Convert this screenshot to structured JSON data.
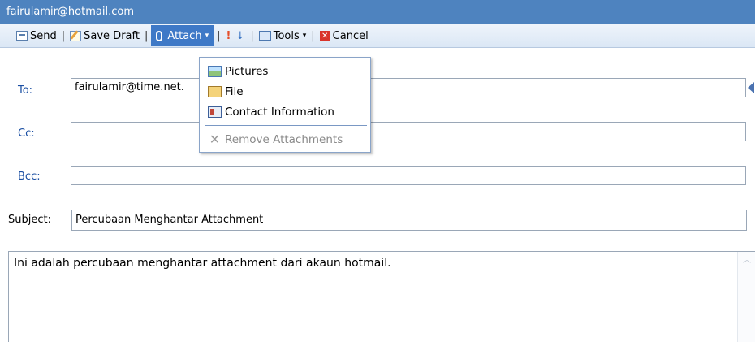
{
  "window": {
    "title": "fairulamir@hotmail.com"
  },
  "toolbar": {
    "send_label": "Send",
    "save_draft_label": "Save Draft",
    "attach_label": "Attach",
    "tools_label": "Tools",
    "cancel_label": "Cancel",
    "separator": "|",
    "importance_high_icon": "!",
    "importance_low_icon": "↓",
    "cancel_icon": "✕",
    "caret": "▾"
  },
  "attach_menu": {
    "items": [
      {
        "label": "Pictures",
        "icon": "pictures-icon"
      },
      {
        "label": "File",
        "icon": "file-icon"
      },
      {
        "label": "Contact Information",
        "icon": "contact-icon"
      }
    ],
    "remove_label": "Remove Attachments",
    "remove_icon": "✕"
  },
  "fields": {
    "to_label": "To:",
    "to_value": "fairulamir@time.net.",
    "cc_label": "Cc:",
    "cc_value": "",
    "bcc_label": "Bcc:",
    "bcc_value": "",
    "subject_label": "Subject:",
    "subject_value": "Percubaan Menghantar Attachment"
  },
  "message": {
    "body": "Ini adalah percubaan menghantar attachment dari akaun hotmail."
  },
  "scroll": {
    "up_arrow": "︿"
  },
  "colors": {
    "title_bar": "#4e83bf",
    "label_blue": "#1b4fa3",
    "attach_active": "#3e79c7"
  }
}
